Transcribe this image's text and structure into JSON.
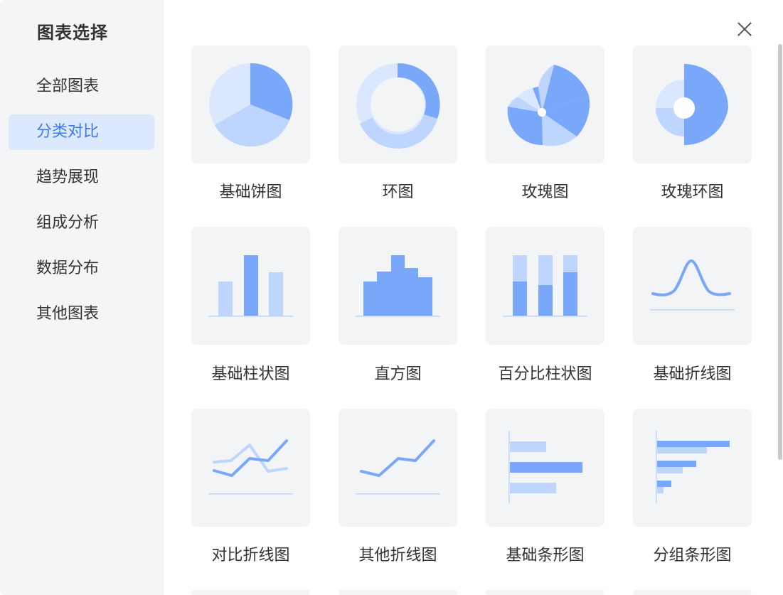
{
  "sidebar": {
    "title": "图表选择",
    "categories": [
      {
        "label": "全部图表"
      },
      {
        "label": "分类对比",
        "active": true
      },
      {
        "label": "趋势展现"
      },
      {
        "label": "组成分析"
      },
      {
        "label": "数据分布"
      },
      {
        "label": "其他图表"
      }
    ]
  },
  "charts": [
    {
      "label": "基础饼图",
      "icon": "pie-chart-icon"
    },
    {
      "label": "环图",
      "icon": "donut-chart-icon"
    },
    {
      "label": "玫瑰图",
      "icon": "rose-chart-icon"
    },
    {
      "label": "玫瑰环图",
      "icon": "rose-ring-chart-icon"
    },
    {
      "label": "基础柱状图",
      "icon": "bar-chart-icon"
    },
    {
      "label": "直方图",
      "icon": "histogram-icon"
    },
    {
      "label": "百分比柱状图",
      "icon": "percent-bar-chart-icon"
    },
    {
      "label": "基础折线图",
      "icon": "line-chart-icon"
    },
    {
      "label": "对比折线图",
      "icon": "compare-line-chart-icon"
    },
    {
      "label": "其他折线图",
      "icon": "other-line-chart-icon"
    },
    {
      "label": "基础条形图",
      "icon": "horizontal-bar-chart-icon"
    },
    {
      "label": "分组条形图",
      "icon": "grouped-bar-chart-icon"
    }
  ],
  "colors": {
    "primary": "#79a8fb",
    "light": "#bed5fd",
    "lighter": "#dbe7fe",
    "active_text": "#3d7ce8"
  }
}
